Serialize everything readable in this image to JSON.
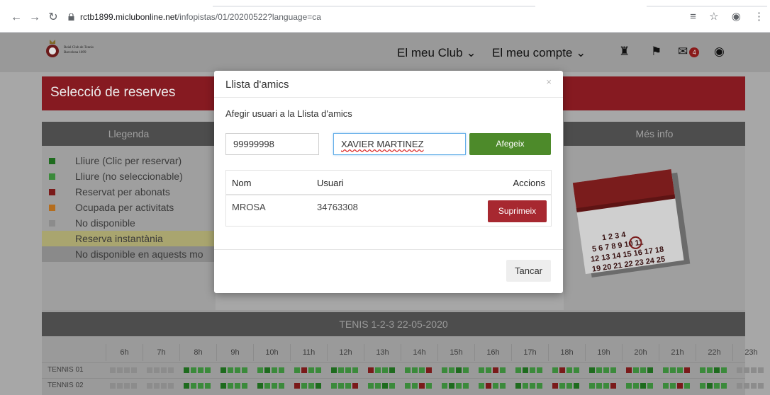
{
  "browser": {
    "back_icon": "←",
    "forward_icon": "→",
    "reload_icon": "↻",
    "url_host": "rctb1899.miclubonline.net",
    "url_path": "/infopistas/01/20200522?language=ca",
    "star_icon": "☆",
    "account_icon": "◉",
    "more_icon": "⋮",
    "translate_icon": "≡"
  },
  "site": {
    "logo_line1": "Reial Club de Tennis",
    "logo_line2": "Barcelona 1899",
    "menu_club": "El meu Club ⌄",
    "menu_account": "El meu compte ⌄",
    "notifications_badge": "4",
    "hero_title": "Selecció de reserves",
    "legend_title": "Llegenda",
    "info_title": "Més info",
    "legend": [
      {
        "label": "Lliure (Clic per reservar)",
        "color": "#1e6b1e"
      },
      {
        "label": "Lliure (no seleccionable)",
        "color": "#3b8a3b"
      },
      {
        "label": "Reservat per abonats",
        "color": "#7a1a1a"
      },
      {
        "label": "Ocupada per activitats",
        "color": "#b46d1e"
      },
      {
        "label": "No disponible",
        "color": "#8c8c8c"
      },
      {
        "label": "Reserva instantània",
        "color": ""
      },
      {
        "label": "No disponible en aquests mo",
        "color": ""
      }
    ],
    "grid_title": "TENIS 1-2-3 22-05-2020",
    "hours": [
      "6h",
      "7h",
      "8h",
      "9h",
      "10h",
      "11h",
      "12h",
      "13h",
      "14h",
      "15h",
      "16h",
      "17h",
      "18h",
      "19h",
      "20h",
      "21h",
      "22h",
      "23h"
    ],
    "courts": [
      "TENNIS 01",
      "TENNIS 02"
    ]
  },
  "modal": {
    "title": "Llista d'amics",
    "close_icon": "×",
    "subtitle": "Afegir usuari a la Llista d'amics",
    "user_number_value": "99999998",
    "user_name_value": "XAVIER MARTINEZ",
    "add_label": "Afegeix",
    "columns": {
      "name": "Nom",
      "user": "Usuari",
      "actions": "Accions"
    },
    "rows": [
      {
        "name": "MROSA",
        "user": "34763308",
        "action": "Suprimeix"
      }
    ],
    "close_label": "Tancar"
  },
  "colors": {
    "brand_red": "#c8202a",
    "add_green": "#4d8a2a",
    "delete_red": "#a72830"
  }
}
